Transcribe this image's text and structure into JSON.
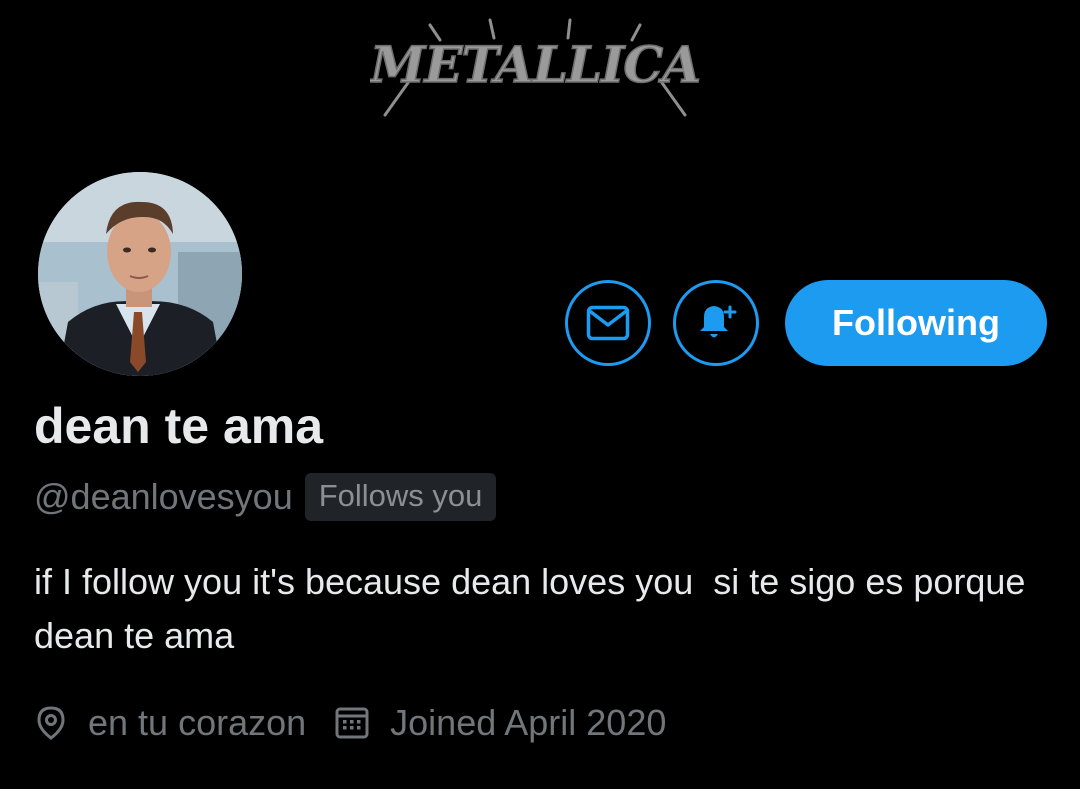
{
  "banner": {
    "logo_text": "METALLICA",
    "background": "#000000"
  },
  "profile": {
    "display_name": "dean te ama",
    "handle": "@deanlovesyou",
    "follows_you_badge": "Follows you",
    "bio": "if I follow you it's because dean loves you  si te sigo es porque dean te ama",
    "location": "en tu corazon",
    "joined": "Joined April 2020"
  },
  "actions": {
    "message_icon": "envelope-icon",
    "notify_icon": "bell-plus-icon",
    "following_label": "Following"
  },
  "meta_icons": {
    "location_icon": "location-pin-icon",
    "joined_icon": "calendar-icon"
  },
  "colors": {
    "accent": "#1d9bf0",
    "text_primary": "#e7e9ea",
    "text_secondary": "#71767b",
    "background": "#000000",
    "badge_background": "#202327"
  }
}
